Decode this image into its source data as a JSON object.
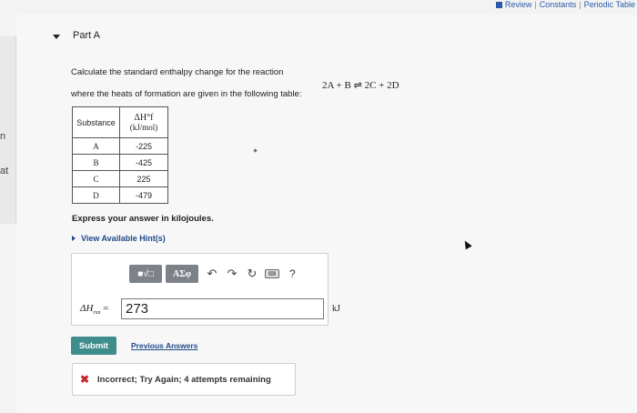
{
  "header": {
    "links": [
      "Review",
      "Constants",
      "Periodic Table"
    ],
    "separator": "|"
  },
  "left_fragments": [
    "n",
    "at"
  ],
  "part": {
    "label": "Part A"
  },
  "question": {
    "line1": "Calculate the standard enthalpy change for the reaction",
    "line2": "where the heats of formation are given in the following table:",
    "reaction": "2A + B ⇌ 2C + 2D"
  },
  "table": {
    "header_substance": "Substance",
    "header_dh": "ΔH°f",
    "header_units": "(kJ/mol)",
    "rows": [
      {
        "substance": "A",
        "value": "-225"
      },
      {
        "substance": "B",
        "value": "-425"
      },
      {
        "substance": "C",
        "value": "225"
      },
      {
        "substance": "D",
        "value": "-479"
      }
    ]
  },
  "instructions": {
    "express": "Express your answer in kilojoules.",
    "hint_link": "View Available Hint(s)"
  },
  "toolbar": {
    "template_btn": "■√□",
    "greek_btn": "ΑΣφ",
    "undo_icon": "↶",
    "redo_icon": "↷",
    "reset_icon": "↻",
    "keyboard_icon": "⌨",
    "help_label": "?"
  },
  "answer": {
    "label_main": "ΔH",
    "label_sub": "rxn",
    "label_eq": "=",
    "value": "273",
    "unit": "kJ"
  },
  "actions": {
    "submit_label": "Submit",
    "previous_label": "Previous Answers"
  },
  "feedback": {
    "icon": "✖",
    "text": "Incorrect; Try Again; 4 attempts remaining"
  },
  "colors": {
    "submit_bg": "#3f8c8c",
    "link": "#1f4a8a",
    "error": "#c0272d"
  }
}
